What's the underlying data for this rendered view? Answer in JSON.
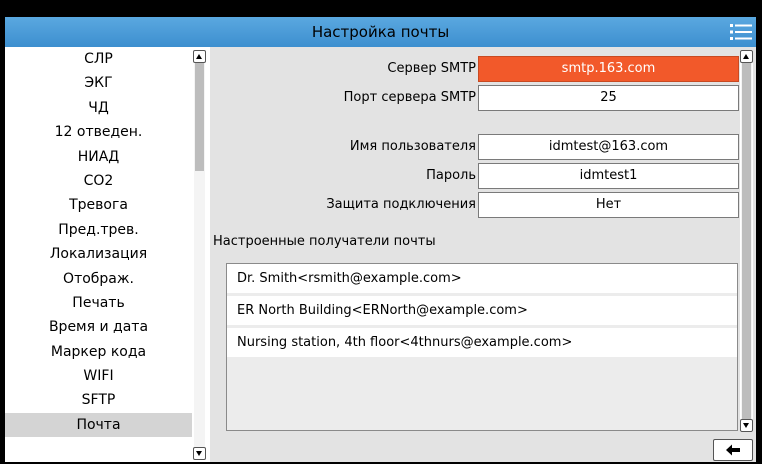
{
  "header": {
    "title": "Настройка почты",
    "menu_icon": "menu-icon"
  },
  "sidebar": {
    "items": [
      {
        "label": "СЛР"
      },
      {
        "label": "ЭКГ"
      },
      {
        "label": "ЧД"
      },
      {
        "label": "12 отведен."
      },
      {
        "label": "НИАД"
      },
      {
        "label": "CO2"
      },
      {
        "label": "Тревога"
      },
      {
        "label": "Пред.трев."
      },
      {
        "label": "Локализация"
      },
      {
        "label": "Отображ."
      },
      {
        "label": "Печать"
      },
      {
        "label": "Время и дата"
      },
      {
        "label": "Маркер кода"
      },
      {
        "label": "WIFI"
      },
      {
        "label": "SFTP"
      },
      {
        "label": "Почта"
      }
    ],
    "selected_index": 15,
    "scroll_thumb_fraction": 0.28
  },
  "form": {
    "smtp_server": {
      "label": "Сервер SMTP",
      "value": "smtp.163.com"
    },
    "smtp_port": {
      "label": "Порт сервера SMTP",
      "value": "25"
    },
    "username": {
      "label": "Имя пользователя",
      "value": "idmtest@163.com"
    },
    "password": {
      "label": "Пароль",
      "value": "idmtest1"
    },
    "security": {
      "label": "Защита подключения",
      "value": "Нет"
    }
  },
  "recipients": {
    "title": "Настроенные получатели почты",
    "items": [
      "Dr. Smith<rsmith@example.com>",
      "ER North Building<ERNorth@example.com>",
      "Nursing station, 4th floor<4thnurs@example.com>"
    ]
  },
  "colors": {
    "titlebar": "#4a9ad8",
    "selected_field": "#f2592a",
    "content_bg": "#e3e3e3"
  },
  "icons": {
    "back": "back-arrow-icon",
    "scroll_up": "scroll-up-icon",
    "scroll_down": "scroll-down-icon"
  }
}
